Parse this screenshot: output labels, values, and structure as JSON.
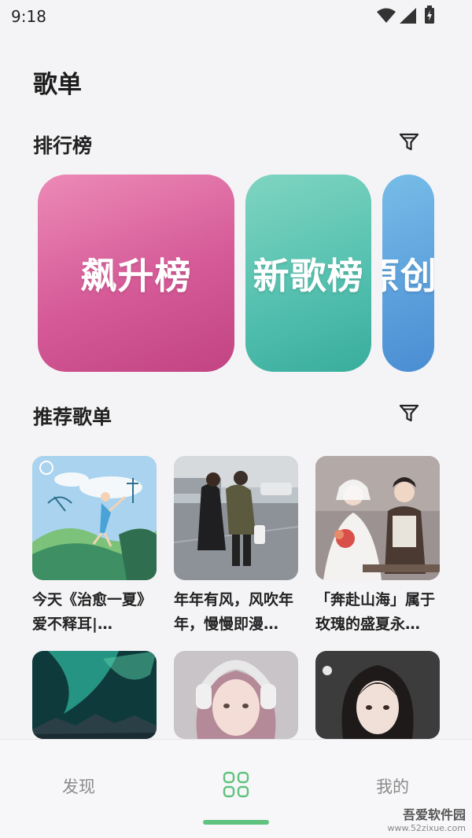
{
  "status_bar": {
    "time": "9:18"
  },
  "page_title": "歌单",
  "rank_section": {
    "title": "排行榜",
    "cards": [
      {
        "label": "飙升榜"
      },
      {
        "label": "新歌榜"
      },
      {
        "label": "原创"
      }
    ]
  },
  "recommend_section": {
    "title": "推荐歌单",
    "playlists": [
      {
        "name": "今天《治愈一夏》爱不释耳|…"
      },
      {
        "name": "年年有风，风吹年年，慢慢即漫…"
      },
      {
        "name": "「奔赴山海」属于玫瑰的盛夏永…"
      },
      {
        "name": ""
      },
      {
        "name": ""
      },
      {
        "name": ""
      }
    ]
  },
  "bottom_nav": {
    "discover": "发现",
    "mine": "我的",
    "active_color": "#5fc27e"
  },
  "watermark": {
    "title": "吾爱软件园",
    "url": "www.52zixue.com"
  },
  "colors": {
    "background": "#f4f4f6",
    "rank_card_1": "#d55a97",
    "rank_card_2": "#52bfae",
    "rank_card_3": "#5b9fdc"
  },
  "icons": {
    "filter": "filter-funnel-icon",
    "wifi": "wifi-icon",
    "signal": "signal-icon",
    "battery": "battery-icon",
    "grid": "grid-apps-icon"
  }
}
